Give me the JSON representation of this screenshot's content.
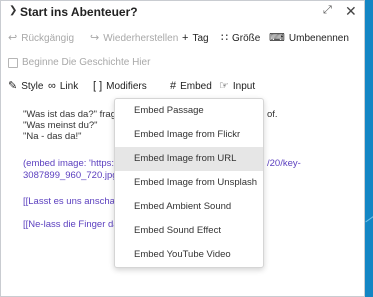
{
  "window": {
    "title": "Start ins Abenteuer?"
  },
  "toolbar1": {
    "undo": "Rückgängig",
    "redo": "Wiederherstellen",
    "tag": "Tag",
    "size": "Größe",
    "rename": "Umbenennen"
  },
  "toolbar2": {
    "start_story": "Beginne Die Geschichte Hier"
  },
  "toolbar3": {
    "style": "Style",
    "link": "Link",
    "modifiers": "Modifiers",
    "embed": "Embed",
    "input": "Input"
  },
  "passage": {
    "line1_left": "\"Was ist das da?\" fragst",
    "line1_right": "of.",
    "line2": "\"Was meinst du?\"",
    "line3": "\"Na - das da!\"",
    "embed_left": "(embed image: 'https://",
    "embed_right": "/20/key-",
    "embed_line2": "3087899_960_720.jpg')",
    "link1": "[[Lasst es uns anschauen",
    "link2": "[[Ne-lass die Finger dav"
  },
  "embed_menu": {
    "items": [
      "Embed Passage",
      "Embed Image from Flickr",
      "Embed Image from URL",
      "Embed Image from Unsplash",
      "Embed Ambient Sound",
      "Embed Sound Effect",
      "Embed YouTube Video"
    ],
    "selected_index": 2
  }
}
